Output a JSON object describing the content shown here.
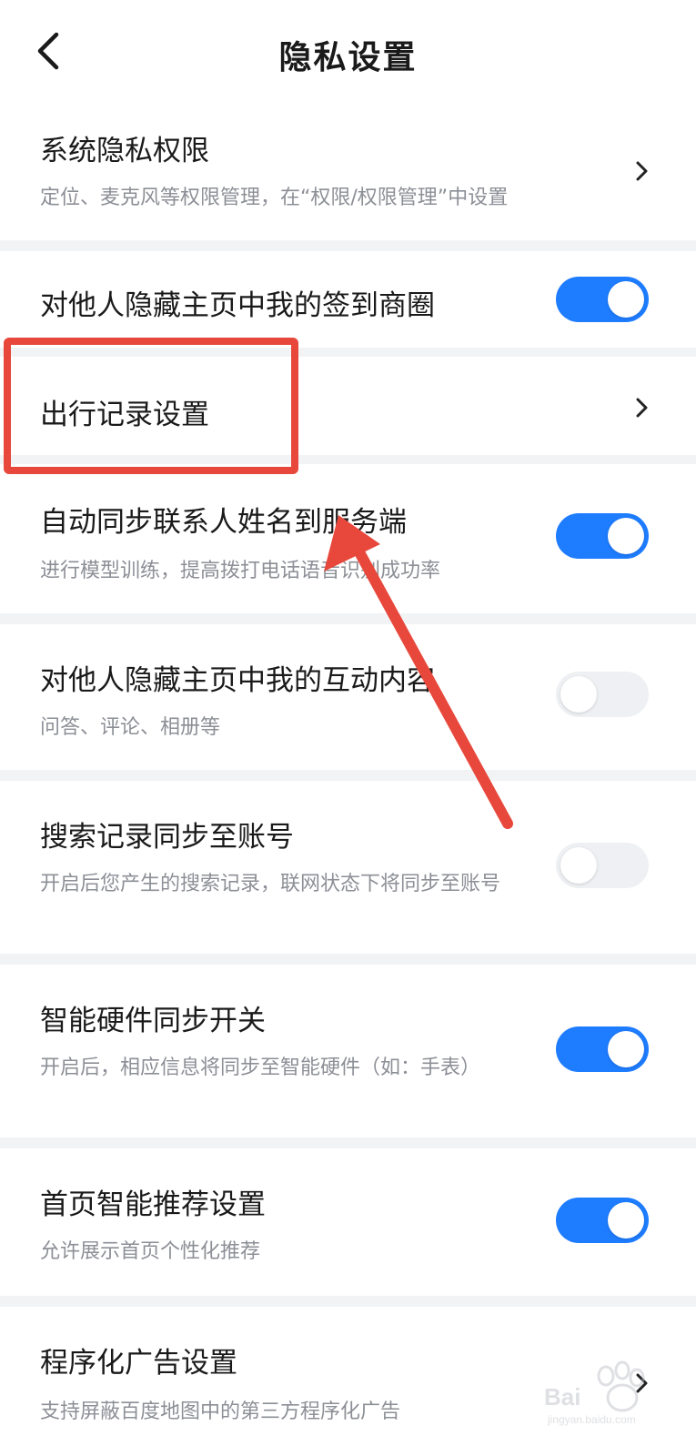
{
  "header": {
    "title": "隐私设置",
    "back_icon": "chevron-left-icon"
  },
  "rows": [
    {
      "title": "系统隐私权限",
      "desc": "定位、麦克风等权限管理，在“权限/权限管理”中设置",
      "control": "chevron"
    },
    {
      "title": "对他人隐藏主页中我的签到商圈",
      "control": "toggle",
      "on": true
    },
    {
      "title": "出行记录设置",
      "control": "chevron"
    },
    {
      "title": "自动同步联系人姓名到服务端",
      "desc": "进行模型训练，提高拨打电话语音识别成功率",
      "control": "toggle",
      "on": true
    },
    {
      "title": "对他人隐藏主页中我的互动内容",
      "desc": "问答、评论、相册等",
      "control": "toggle",
      "on": false
    },
    {
      "title": "搜索记录同步至账号",
      "desc": "开启后您产生的搜索记录，联网状态下将同步至账号",
      "control": "toggle",
      "on": false
    },
    {
      "title": "智能硬件同步开关",
      "desc": "开启后，相应信息将同步至智能硬件（如：手表）",
      "control": "toggle",
      "on": true
    },
    {
      "title": "首页智能推荐设置",
      "desc": "允许展示首页个性化推荐",
      "control": "toggle",
      "on": true
    },
    {
      "title": "程序化广告设置",
      "desc": "支持屏蔽百度地图中的第三方程序化广告",
      "control": "chevron"
    }
  ],
  "annotation": {
    "highlight_color": "#e8483c",
    "arrow_color": "#e8483c"
  },
  "watermark": {
    "brand": "Bai度经验",
    "url": "jingyan.baidu.com"
  },
  "colors": {
    "toggle_on": "#1e7cff",
    "toggle_off": "#eef0f3",
    "background": "#f2f3f5"
  }
}
